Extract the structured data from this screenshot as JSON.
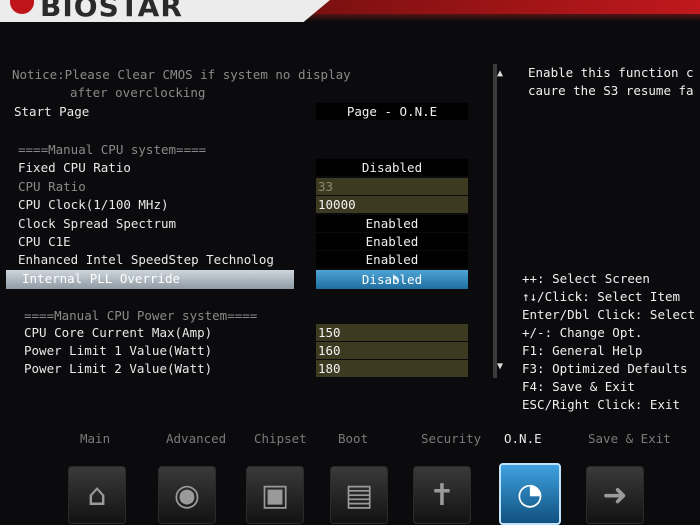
{
  "brand": {
    "name": "BIOSTAR"
  },
  "notice": {
    "line1": "Notice:Please Clear CMOS if system no display",
    "line2": "after overclocking"
  },
  "start_page": {
    "label": "Start Page",
    "value": "Page - O.N.E"
  },
  "sections": {
    "cpu_system": "====Manual CPU system====",
    "cpu_power": "====Manual CPU Power system===="
  },
  "settings": [
    {
      "label": "Fixed CPU Ratio",
      "value": "Disabled"
    },
    {
      "label": "CPU Ratio",
      "value": "33"
    },
    {
      "label": "CPU Clock(1/100 MHz)",
      "value": "10000"
    },
    {
      "label": "Clock Spread Spectrum",
      "value": "Enabled"
    },
    {
      "label": "CPU C1E",
      "value": "Enabled"
    },
    {
      "label": "Enhanced Intel SpeedStep Technolog",
      "value": "Enabled"
    },
    {
      "label": "Internal PLL Override",
      "value": "Disabled"
    }
  ],
  "power_settings": [
    {
      "label": "CPU Core Current Max(Amp)",
      "value": "150"
    },
    {
      "label": "Power Limit 1 Value(Watt)",
      "value": "160"
    },
    {
      "label": "Power Limit 2 Value(Watt)",
      "value": "180"
    }
  ],
  "help_text": {
    "line1": "Enable this function c",
    "line2": "caure the S3 resume fa"
  },
  "keys": [
    "++: Select Screen",
    "↑↓/Click: Select Item",
    "Enter/Dbl Click: Select",
    "+/-: Change Opt.",
    "F1: General Help",
    "F3: Optimized Defaults",
    "F4: Save & Exit",
    "ESC/Right Click: Exit"
  ],
  "nav": [
    {
      "label": "Main",
      "icon": "home-icon"
    },
    {
      "label": "Advanced",
      "icon": "joystick-icon"
    },
    {
      "label": "Chipset",
      "icon": "chip-icon"
    },
    {
      "label": "Boot",
      "icon": "drives-icon"
    },
    {
      "label": "Security",
      "icon": "shield-icon"
    },
    {
      "label": "O.N.E",
      "icon": "speedometer-icon"
    },
    {
      "label": "Save & Exit",
      "icon": "exit-icon"
    }
  ]
}
